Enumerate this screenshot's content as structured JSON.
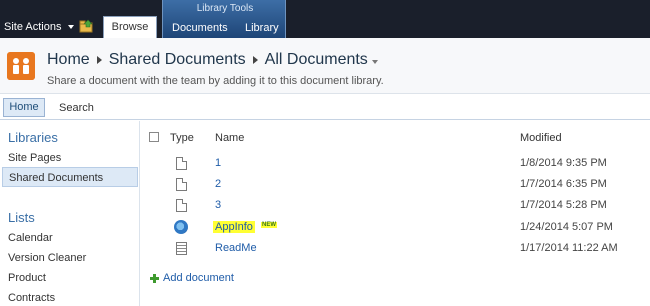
{
  "ribbon": {
    "site_actions": "Site Actions",
    "browse_tab": "Browse",
    "context_group": "Library Tools",
    "documents_tab": "Documents",
    "library_tab": "Library"
  },
  "title_area": {
    "breadcrumb": [
      "Home",
      "Shared Documents",
      "All Documents"
    ],
    "description": "Share a document with the team by adding it to this document library."
  },
  "quick_nav": {
    "home": "Home",
    "search": "Search"
  },
  "left_nav": {
    "libraries_heading": "Libraries",
    "libraries": [
      {
        "label": "Site Pages",
        "selected": false
      },
      {
        "label": "Shared Documents",
        "selected": true
      }
    ],
    "lists_heading": "Lists",
    "lists": [
      "Calendar",
      "Version Cleaner",
      "Product",
      "Contracts"
    ]
  },
  "doc_list": {
    "columns": {
      "type": "Type",
      "name": "Name",
      "modified": "Modified"
    },
    "rows": [
      {
        "icon": "document-icon",
        "name": "1",
        "modified": "1/8/2014 9:35 PM"
      },
      {
        "icon": "document-icon",
        "name": "2",
        "modified": "1/7/2014 6:35 PM"
      },
      {
        "icon": "document-icon",
        "name": "3",
        "modified": "1/7/2014 5:28 PM"
      },
      {
        "icon": "internet-explorer-icon",
        "name": "AppInfo",
        "badge": "NEW",
        "highlighted": true,
        "modified": "1/24/2014 5:07 PM"
      },
      {
        "icon": "text-document-icon",
        "name": "ReadMe",
        "modified": "1/17/2014 11:22 AM"
      }
    ],
    "add_document": "Add document"
  },
  "colors": {
    "ribbon_dark": "#1a1f2b",
    "context_tab": "#2e5a91",
    "link": "#1f5ca8",
    "highlight": "#ffff33",
    "logo_orange": "#e2641a"
  }
}
